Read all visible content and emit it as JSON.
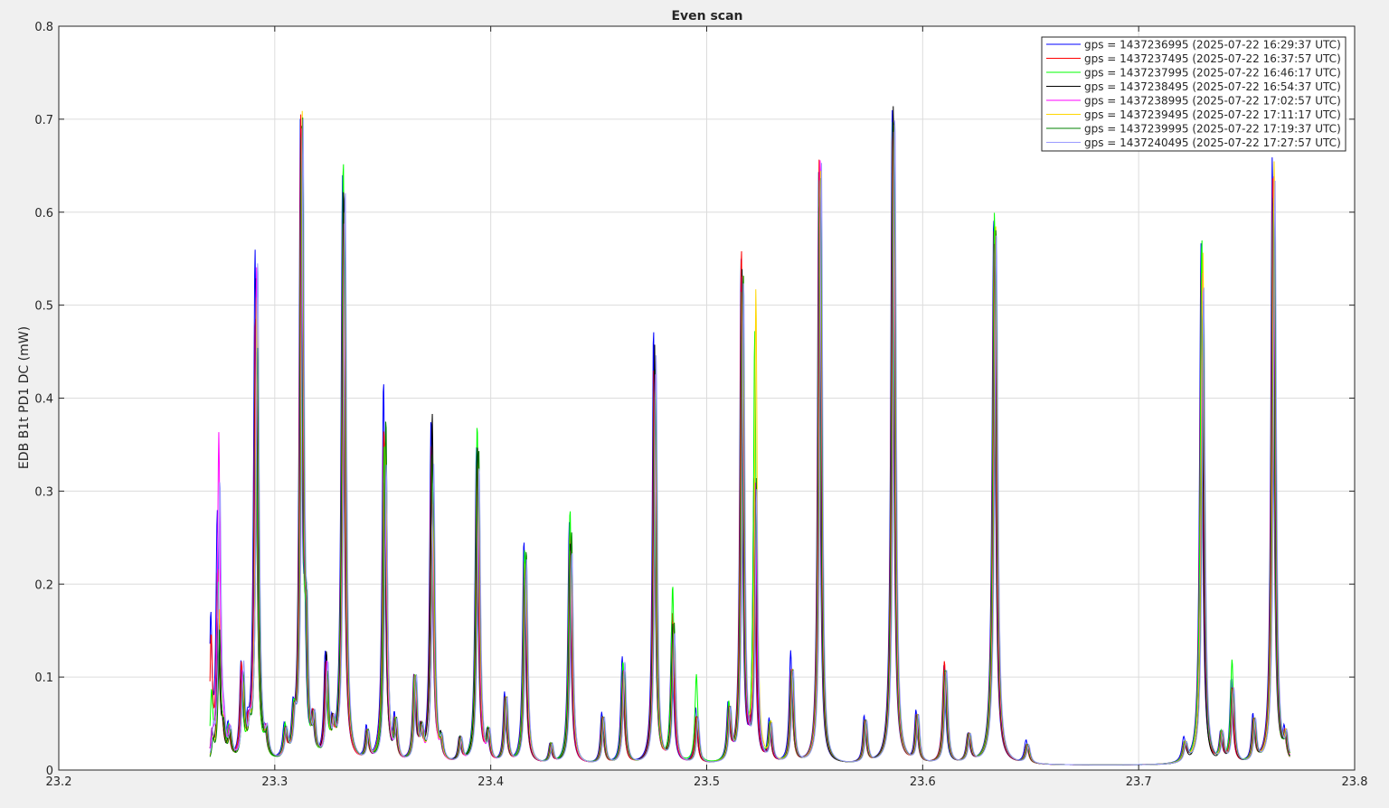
{
  "figure": {
    "background": "#f0f0f0",
    "axes_background": "#ffffff"
  },
  "chart_data": {
    "type": "line",
    "title": "Even scan",
    "xlabel": "",
    "ylabel": "EDB B1t PD1 DC (mW)",
    "xlim": [
      23.2,
      23.8
    ],
    "ylim": [
      0,
      0.8
    ],
    "xticks": [
      23.2,
      23.3,
      23.4,
      23.5,
      23.6,
      23.7,
      23.8
    ],
    "yticks": [
      0,
      0.1,
      0.2,
      0.3,
      0.4,
      0.5,
      0.6,
      0.7,
      0.8
    ],
    "xtick_labels": [
      "23.2",
      "23.3",
      "23.4",
      "23.5",
      "23.6",
      "23.7",
      "23.8"
    ],
    "ytick_labels": [
      "0",
      "0.1",
      "0.2",
      "0.3",
      "0.4",
      "0.5",
      "0.6",
      "0.7",
      "0.8"
    ],
    "grid": true,
    "legend_position": "top-right",
    "x_range": [
      23.27,
      23.77
    ],
    "baseline": 0.005,
    "peaks": [
      {
        "x": 23.271,
        "heights": [
          0.15,
          0.13,
          0.07,
          0.03,
          0.02,
          0.02,
          0.02,
          0.03
        ],
        "width": 0.0007
      },
      {
        "x": 23.274,
        "heights": [
          0.26,
          0.2,
          0.19,
          0.15,
          0.35,
          0.16,
          0.14,
          0.3
        ],
        "width": 0.0007
      },
      {
        "x": 23.276,
        "heights": [
          0.03,
          0.03,
          0.03,
          0.03,
          0.03,
          0.03,
          0.03,
          0.03
        ],
        "width": 0.0008
      },
      {
        "x": 23.279,
        "heights": [
          0.035,
          0.03,
          0.035,
          0.03,
          0.03,
          0.03,
          0.03,
          0.03
        ],
        "width": 0.0009
      },
      {
        "x": 23.285,
        "heights": [
          0.1,
          0.1,
          0.08,
          0.09,
          0.09,
          0.08,
          0.09,
          0.1
        ],
        "width": 0.0008
      },
      {
        "x": 23.288,
        "heights": [
          0.025,
          0.025,
          0.025,
          0.025,
          0.025,
          0.025,
          0.025,
          0.025
        ],
        "width": 0.0008
      },
      {
        "x": 23.2915,
        "heights": [
          0.55,
          0.48,
          0.45,
          0.52,
          0.53,
          0.5,
          0.45,
          0.54
        ],
        "width": 0.0008
      },
      {
        "x": 23.296,
        "heights": [
          0.025,
          0.025,
          0.025,
          0.025,
          0.025,
          0.025,
          0.025,
          0.025
        ],
        "width": 0.0008
      },
      {
        "x": 23.305,
        "heights": [
          0.035,
          0.03,
          0.035,
          0.03,
          0.03,
          0.03,
          0.03,
          0.03
        ],
        "width": 0.0009
      },
      {
        "x": 23.309,
        "heights": [
          0.04,
          0.035,
          0.04,
          0.035,
          0.035,
          0.035,
          0.035,
          0.035
        ],
        "width": 0.0008
      },
      {
        "x": 23.3125,
        "heights": [
          0.68,
          0.68,
          0.66,
          0.68,
          0.68,
          0.69,
          0.68,
          0.68
        ],
        "width": 0.0007
      },
      {
        "x": 23.3145,
        "heights": [
          0.12,
          0.13,
          0.1,
          0.11,
          0.1,
          0.1,
          0.1,
          0.11
        ],
        "width": 0.0007
      },
      {
        "x": 23.318,
        "heights": [
          0.04,
          0.04,
          0.04,
          0.04,
          0.04,
          0.04,
          0.04,
          0.04
        ],
        "width": 0.0008
      },
      {
        "x": 23.324,
        "heights": [
          0.11,
          0.1,
          0.09,
          0.11,
          0.1,
          0.09,
          0.09,
          0.1
        ],
        "width": 0.0008
      },
      {
        "x": 23.327,
        "heights": [
          0.03,
          0.03,
          0.03,
          0.03,
          0.03,
          0.03,
          0.03,
          0.03
        ],
        "width": 0.0008
      },
      {
        "x": 23.332,
        "heights": [
          0.63,
          0.6,
          0.65,
          0.62,
          0.58,
          0.59,
          0.6,
          0.62
        ],
        "width": 0.0008
      },
      {
        "x": 23.343,
        "heights": [
          0.035,
          0.03,
          0.03,
          0.03,
          0.03,
          0.03,
          0.03,
          0.03
        ],
        "width": 0.0008
      },
      {
        "x": 23.351,
        "heights": [
          0.41,
          0.36,
          0.34,
          0.3,
          0.32,
          0.35,
          0.37,
          0.32
        ],
        "width": 0.0008
      },
      {
        "x": 23.356,
        "heights": [
          0.045,
          0.04,
          0.04,
          0.04,
          0.04,
          0.04,
          0.04,
          0.04
        ],
        "width": 0.0008
      },
      {
        "x": 23.365,
        "heights": [
          0.09,
          0.09,
          0.09,
          0.08,
          0.09,
          0.09,
          0.09,
          0.09
        ],
        "width": 0.0008
      },
      {
        "x": 23.368,
        "heights": [
          0.03,
          0.03,
          0.03,
          0.03,
          0.03,
          0.03,
          0.03,
          0.03
        ],
        "width": 0.0008
      },
      {
        "x": 23.373,
        "heights": [
          0.37,
          0.34,
          0.33,
          0.375,
          0.26,
          0.28,
          0.3,
          0.32
        ],
        "width": 0.0008
      },
      {
        "x": 23.377,
        "heights": [
          0.02,
          0.02,
          0.02,
          0.02,
          0.02,
          0.02,
          0.02,
          0.02
        ],
        "width": 0.0008
      },
      {
        "x": 23.386,
        "heights": [
          0.025,
          0.025,
          0.025,
          0.025,
          0.025,
          0.025,
          0.025,
          0.025
        ],
        "width": 0.0008
      },
      {
        "x": 23.394,
        "heights": [
          0.34,
          0.33,
          0.365,
          0.34,
          0.3,
          0.33,
          0.34,
          0.32
        ],
        "width": 0.0008
      },
      {
        "x": 23.399,
        "heights": [
          0.03,
          0.03,
          0.03,
          0.03,
          0.03,
          0.03,
          0.03,
          0.03
        ],
        "width": 0.0008
      },
      {
        "x": 23.407,
        "heights": [
          0.075,
          0.07,
          0.07,
          0.07,
          0.07,
          0.07,
          0.07,
          0.07
        ],
        "width": 0.0008
      },
      {
        "x": 23.416,
        "heights": [
          0.24,
          0.22,
          0.23,
          0.2,
          0.21,
          0.22,
          0.23,
          0.22
        ],
        "width": 0.0008
      },
      {
        "x": 23.428,
        "heights": [
          0.02,
          0.02,
          0.02,
          0.02,
          0.02,
          0.02,
          0.02,
          0.02
        ],
        "width": 0.0008
      },
      {
        "x": 23.437,
        "heights": [
          0.26,
          0.25,
          0.275,
          0.24,
          0.23,
          0.24,
          0.25,
          0.23
        ],
        "width": 0.0008
      },
      {
        "x": 23.452,
        "heights": [
          0.055,
          0.05,
          0.05,
          0.05,
          0.05,
          0.05,
          0.05,
          0.05
        ],
        "width": 0.0008
      },
      {
        "x": 23.4615,
        "heights": [
          0.115,
          0.1,
          0.11,
          0.1,
          0.1,
          0.1,
          0.1,
          0.11
        ],
        "width": 0.0008
      },
      {
        "x": 23.476,
        "heights": [
          0.47,
          0.43,
          0.41,
          0.45,
          0.42,
          0.41,
          0.43,
          0.44
        ],
        "width": 0.0007
      },
      {
        "x": 23.4845,
        "heights": [
          0.15,
          0.16,
          0.19,
          0.15,
          0.14,
          0.15,
          0.15,
          0.14
        ],
        "width": 0.0008
      },
      {
        "x": 23.4955,
        "heights": [
          0.06,
          0.05,
          0.095,
          0.05,
          0.05,
          0.05,
          0.05,
          0.05
        ],
        "width": 0.0008
      },
      {
        "x": 23.5105,
        "heights": [
          0.06,
          0.055,
          0.06,
          0.055,
          0.055,
          0.055,
          0.055,
          0.055
        ],
        "width": 0.0008
      },
      {
        "x": 23.5165,
        "heights": [
          0.54,
          0.555,
          0.51,
          0.53,
          0.52,
          0.52,
          0.53,
          0.52
        ],
        "width": 0.0007
      },
      {
        "x": 23.5225,
        "heights": [
          0.3,
          0.3,
          0.46,
          0.3,
          0.3,
          0.505,
          0.3,
          0.29
        ],
        "width": 0.0007
      },
      {
        "x": 23.5295,
        "heights": [
          0.045,
          0.04,
          0.04,
          0.04,
          0.04,
          0.04,
          0.04,
          0.04
        ],
        "width": 0.0008
      },
      {
        "x": 23.5395,
        "heights": [
          0.12,
          0.1,
          0.1,
          0.1,
          0.1,
          0.1,
          0.1,
          0.1
        ],
        "width": 0.0008
      },
      {
        "x": 23.5525,
        "heights": [
          0.64,
          0.65,
          0.63,
          0.62,
          0.66,
          0.64,
          0.63,
          0.65
        ],
        "width": 0.0007
      },
      {
        "x": 23.5735,
        "heights": [
          0.05,
          0.045,
          0.045,
          0.045,
          0.045,
          0.045,
          0.045,
          0.045
        ],
        "width": 0.0008
      },
      {
        "x": 23.5865,
        "heights": [
          0.705,
          0.69,
          0.7,
          0.71,
          0.68,
          0.69,
          0.7,
          0.7
        ],
        "width": 0.0008
      },
      {
        "x": 23.5975,
        "heights": [
          0.055,
          0.05,
          0.05,
          0.05,
          0.05,
          0.05,
          0.05,
          0.05
        ],
        "width": 0.0008
      },
      {
        "x": 23.6105,
        "heights": [
          0.105,
          0.11,
          0.1,
          0.1,
          0.1,
          0.1,
          0.1,
          0.1
        ],
        "width": 0.0009
      },
      {
        "x": 23.6215,
        "heights": [
          0.03,
          0.03,
          0.03,
          0.03,
          0.03,
          0.03,
          0.03,
          0.03
        ],
        "width": 0.001
      },
      {
        "x": 23.6335,
        "heights": [
          0.59,
          0.58,
          0.595,
          0.56,
          0.57,
          0.585,
          0.58,
          0.57
        ],
        "width": 0.0009
      },
      {
        "x": 23.6485,
        "heights": [
          0.025,
          0.02,
          0.02,
          0.02,
          0.02,
          0.02,
          0.02,
          0.02
        ],
        "width": 0.001
      },
      {
        "x": 23.7215,
        "heights": [
          0.025,
          0.02,
          0.02,
          0.02,
          0.02,
          0.02,
          0.02,
          0.02
        ],
        "width": 0.001
      },
      {
        "x": 23.7295,
        "heights": [
          0.56,
          0.54,
          0.57,
          0.4,
          0.53,
          0.55,
          0.5,
          0.52
        ],
        "width": 0.0008
      },
      {
        "x": 23.7385,
        "heights": [
          0.03,
          0.03,
          0.03,
          0.03,
          0.03,
          0.03,
          0.03,
          0.03
        ],
        "width": 0.0008
      },
      {
        "x": 23.7435,
        "heights": [
          0.09,
          0.08,
          0.11,
          0.08,
          0.08,
          0.08,
          0.08,
          0.08
        ],
        "width": 0.0008
      },
      {
        "x": 23.7535,
        "heights": [
          0.05,
          0.045,
          0.045,
          0.045,
          0.045,
          0.045,
          0.045,
          0.045
        ],
        "width": 0.0008
      },
      {
        "x": 23.7625,
        "heights": [
          0.655,
          0.63,
          0.61,
          0.62,
          0.64,
          0.65,
          0.6,
          0.63
        ],
        "width": 0.0008
      },
      {
        "x": 23.768,
        "heights": [
          0.03,
          0.025,
          0.025,
          0.025,
          0.025,
          0.025,
          0.025,
          0.025
        ],
        "width": 0.0008
      }
    ],
    "series": [
      {
        "name": "gps = 1437236995 (2025-07-22 16:29:37 UTC)",
        "color": "#0000ff"
      },
      {
        "name": "gps = 1437237495 (2025-07-22 16:37:57 UTC)",
        "color": "#ff0000"
      },
      {
        "name": "gps = 1437237995 (2025-07-22 16:46:17 UTC)",
        "color": "#00ff00"
      },
      {
        "name": "gps = 1437238495 (2025-07-22 16:54:37 UTC)",
        "color": "#000000"
      },
      {
        "name": "gps = 1437238995 (2025-07-22 17:02:57 UTC)",
        "color": "#ff00ff"
      },
      {
        "name": "gps = 1437239495 (2025-07-22 17:11:17 UTC)",
        "color": "#ffd700"
      },
      {
        "name": "gps = 1437239995 (2025-07-22 17:19:37 UTC)",
        "color": "#008000"
      },
      {
        "name": "gps = 1437240495 (2025-07-22 17:27:57 UTC)",
        "color": "#9a9aff"
      }
    ]
  }
}
